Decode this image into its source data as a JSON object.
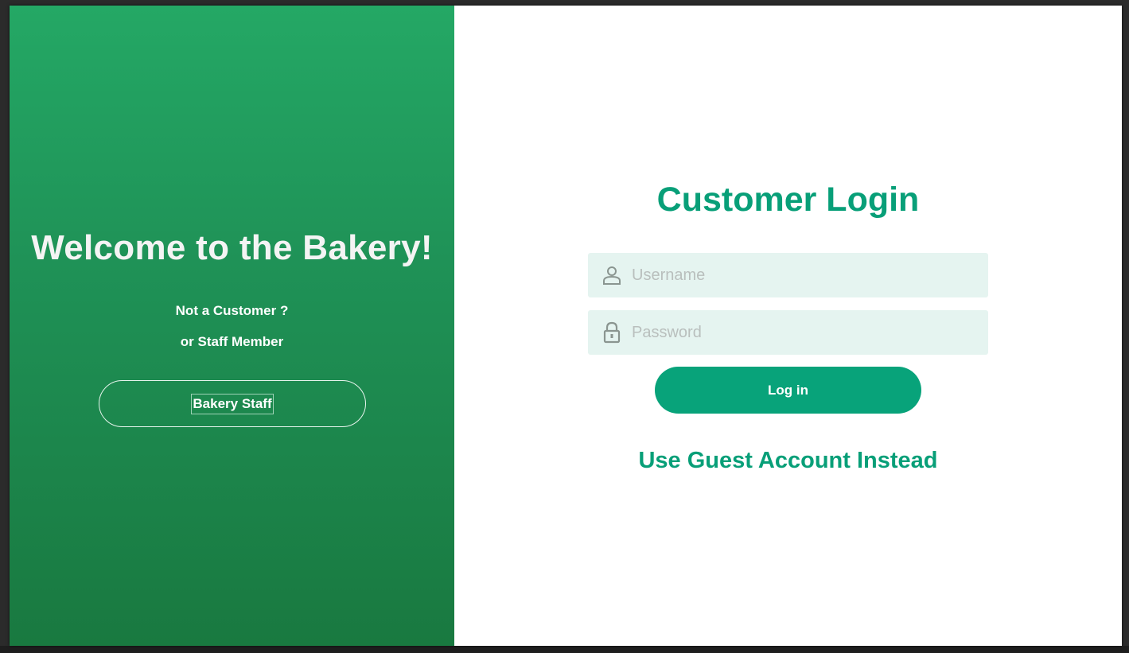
{
  "left_panel": {
    "welcome_title": "Welcome to the Bakery!",
    "subtitle_line1": "Not a Customer ?",
    "subtitle_line2": "or Staff Member",
    "staff_button_label": "Bakery Staff"
  },
  "right_panel": {
    "login_title": "Customer Login",
    "username": {
      "placeholder": "Username",
      "value": "",
      "icon": "user-icon"
    },
    "password": {
      "placeholder": "Password",
      "value": "",
      "icon": "lock-icon"
    },
    "login_button_label": "Log in",
    "guest_link_label": "Use Guest Account Instead"
  },
  "colors": {
    "accent": "#08a37a",
    "left_gradient_top": "#24a865",
    "left_gradient_bottom": "#197940",
    "field_background": "#e5f4f0"
  }
}
